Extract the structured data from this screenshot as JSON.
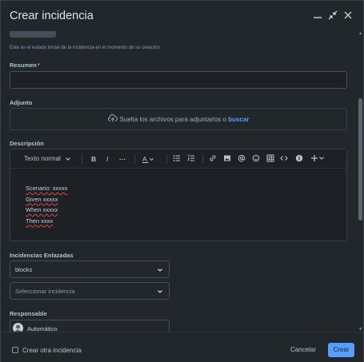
{
  "dialog": {
    "title": "Crear incidencia"
  },
  "status_help": "Este es el estado inicial de la incidencia en el momento de su creación",
  "summary": {
    "label": "Resumen",
    "required_mark": "*",
    "value": ""
  },
  "attachment": {
    "label": "Adjunto",
    "drop_text": "Suelta los archivos para adjuntarlos o",
    "browse_link": "buscar"
  },
  "description": {
    "label": "Descripción",
    "toolbar": {
      "text_style": "Texto normal",
      "bold": "B",
      "italic": "I",
      "more": "···",
      "color": "A"
    },
    "lines": [
      "Scenario: xxxxx",
      "Given xxxxx",
      "When xxxxx",
      "Then xxxx"
    ]
  },
  "linked_issues": {
    "label": "Incidencias Enlazadas",
    "relation": "blocks",
    "issue_placeholder": "Seleccionar incidencia"
  },
  "assignee": {
    "label": "Responsable",
    "value": "Automático"
  },
  "footer": {
    "create_another_label": "Crear otra incidencia",
    "cancel_label": "Cancelar",
    "create_label": "Crear"
  },
  "colors": {
    "background": "#22272b",
    "accent": "#579dff",
    "required": "#f87168"
  }
}
